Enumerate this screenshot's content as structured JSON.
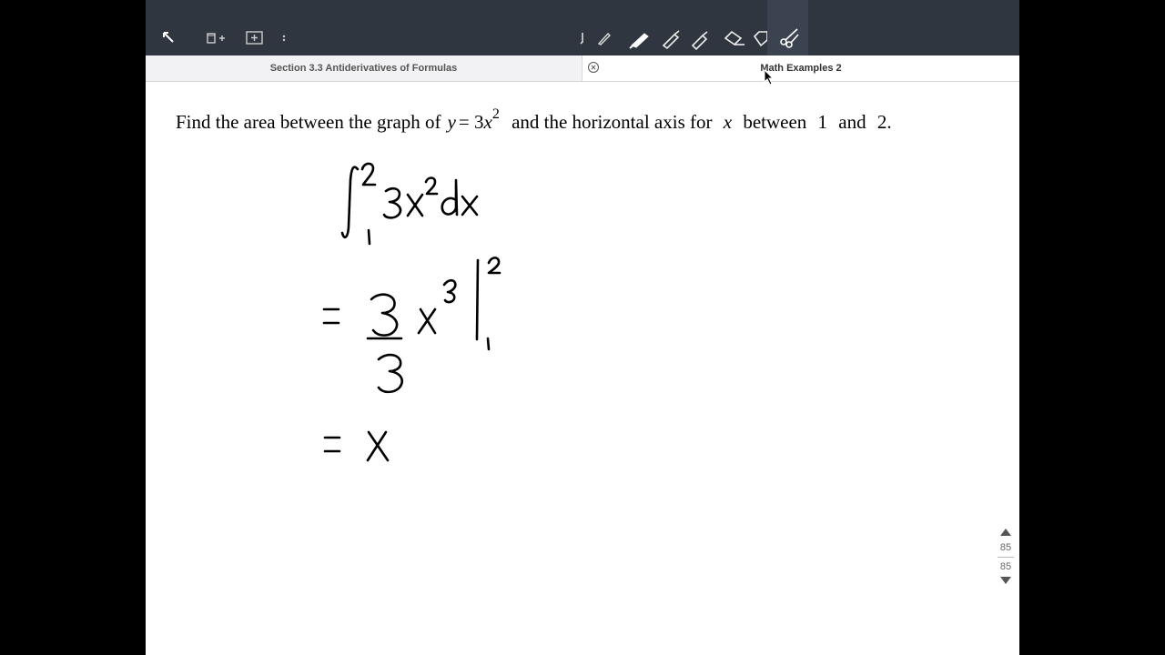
{
  "toolbar": {
    "icons": [
      "back-arrow-icon",
      "page-layout-icon",
      "add-page-icon",
      "more-icon",
      "pen-icon",
      "pencil-icon",
      "fountain-pen-icon",
      "marker-icon",
      "highlighter-icon",
      "eraser-icon",
      "lasso-icon",
      "scissors-icon"
    ]
  },
  "tabs": [
    {
      "label": "Section 3.3 Antiderivatives of Formulas"
    },
    {
      "label": "Math Examples 2"
    }
  ],
  "problem": {
    "p1": "Find the area between the graph of",
    "y": "y",
    "eq": "= 3",
    "x": "x",
    "exp": "2",
    "p2": "and the horizontal axis for",
    "xvar": "x",
    "between": "between",
    "n1": "1",
    "and": "and",
    "n2": "2."
  },
  "pager": {
    "current": "85",
    "total": "85"
  },
  "colors": {
    "toolbar": "#2f363f",
    "tabbar": "#f2f2f4",
    "ink": "#000000"
  }
}
